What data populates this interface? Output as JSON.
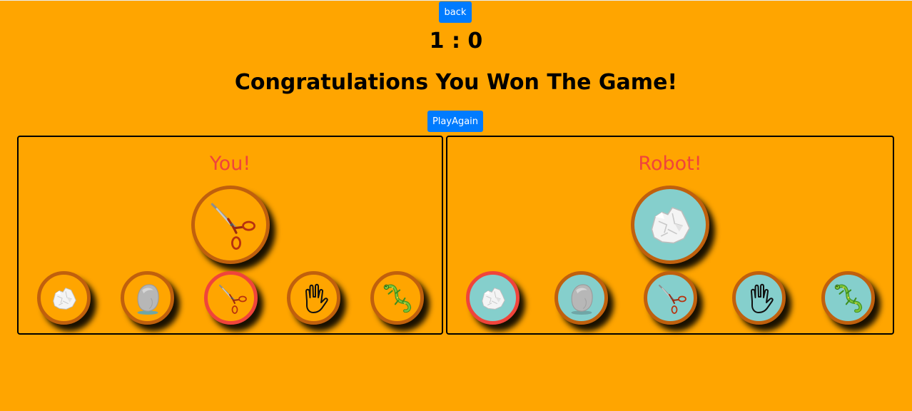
{
  "nav": {
    "back_label": "back"
  },
  "score": {
    "text": "1 : 0",
    "you": 1,
    "robot": 0
  },
  "result": {
    "message": "Congratulations You Won The Game!"
  },
  "actions": {
    "play_again_label": "PlayAgain"
  },
  "panels": {
    "you": {
      "title": "You!",
      "chosen_icon": "scissors-icon",
      "options": [
        "paper-icon",
        "rock-icon",
        "scissors-icon",
        "spock-icon",
        "lizard-icon"
      ],
      "selected_option": "scissors-icon"
    },
    "robot": {
      "title": "Robot!",
      "chosen_icon": "paper-icon",
      "options": [
        "paper-icon",
        "rock-icon",
        "scissors-icon",
        "spock-icon",
        "lizard-icon"
      ],
      "selected_option": "paper-icon"
    }
  },
  "colors": {
    "background": "#ffa500",
    "button": "#007bff",
    "title_text": "#f0443b",
    "coin_border": "#c0600d",
    "selected_border": "#f0443b",
    "robot_coin_bg": "#85cfcc"
  }
}
